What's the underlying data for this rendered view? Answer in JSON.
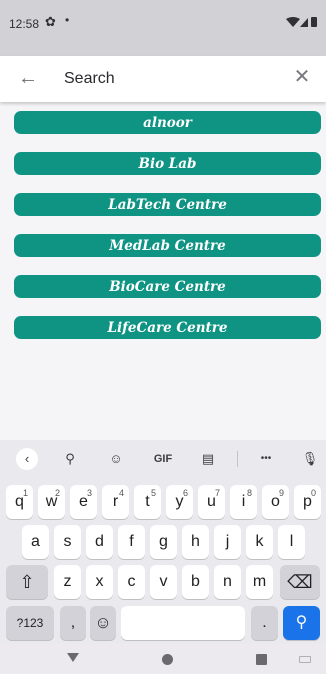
{
  "status_bar": {
    "time": "12:58",
    "gear_glyph": "✿",
    "dot_glyph": "•",
    "icons": [
      "settings-icon",
      "notification-dot-icon",
      "wifi-icon",
      "signal-icon",
      "battery-icon"
    ]
  },
  "search": {
    "placeholder": "Search",
    "value": "",
    "back_glyph": "←",
    "close_glyph": "✕"
  },
  "results": [
    {
      "label": "alnoor"
    },
    {
      "label": "Bio Lab"
    },
    {
      "label": "LabTech Centre"
    },
    {
      "label": "MedLab Centre"
    },
    {
      "label": "BioCare Centre"
    },
    {
      "label": "LifeCare Centre"
    }
  ],
  "colors": {
    "result_bg": "#0f9484",
    "accent": "#1a73e8"
  },
  "keyboard": {
    "toolbar": [
      {
        "name": "collapse-icon",
        "glyph": "‹"
      },
      {
        "name": "search-icon",
        "glyph": "⚲"
      },
      {
        "name": "sticker-icon",
        "glyph": "☺"
      },
      {
        "name": "gif-button",
        "glyph": "GIF"
      },
      {
        "name": "clipboard-icon",
        "glyph": "▤"
      },
      {
        "name": "more-icon",
        "glyph": "•••"
      },
      {
        "name": "microphone-icon",
        "glyph": "🎙"
      }
    ],
    "row1": [
      {
        "k": "q",
        "n": "1"
      },
      {
        "k": "w",
        "n": "2"
      },
      {
        "k": "e",
        "n": "3"
      },
      {
        "k": "r",
        "n": "4"
      },
      {
        "k": "t",
        "n": "5"
      },
      {
        "k": "y",
        "n": "6"
      },
      {
        "k": "u",
        "n": "7"
      },
      {
        "k": "i",
        "n": "8"
      },
      {
        "k": "o",
        "n": "9"
      },
      {
        "k": "p",
        "n": "0"
      }
    ],
    "row2": [
      "a",
      "s",
      "d",
      "f",
      "g",
      "h",
      "j",
      "k",
      "l"
    ],
    "row3": [
      "z",
      "x",
      "c",
      "v",
      "b",
      "n",
      "m"
    ],
    "shift_glyph": "⇧",
    "backspace_glyph": "⌫",
    "symbols_label": "?123",
    "comma_label": ",",
    "emoji_glyph": "☺",
    "period_label": ".",
    "search_glyph": "⚲"
  },
  "nav": {
    "items": [
      "back-icon",
      "home-icon",
      "recents-icon",
      "keyboard-switch-icon"
    ]
  }
}
